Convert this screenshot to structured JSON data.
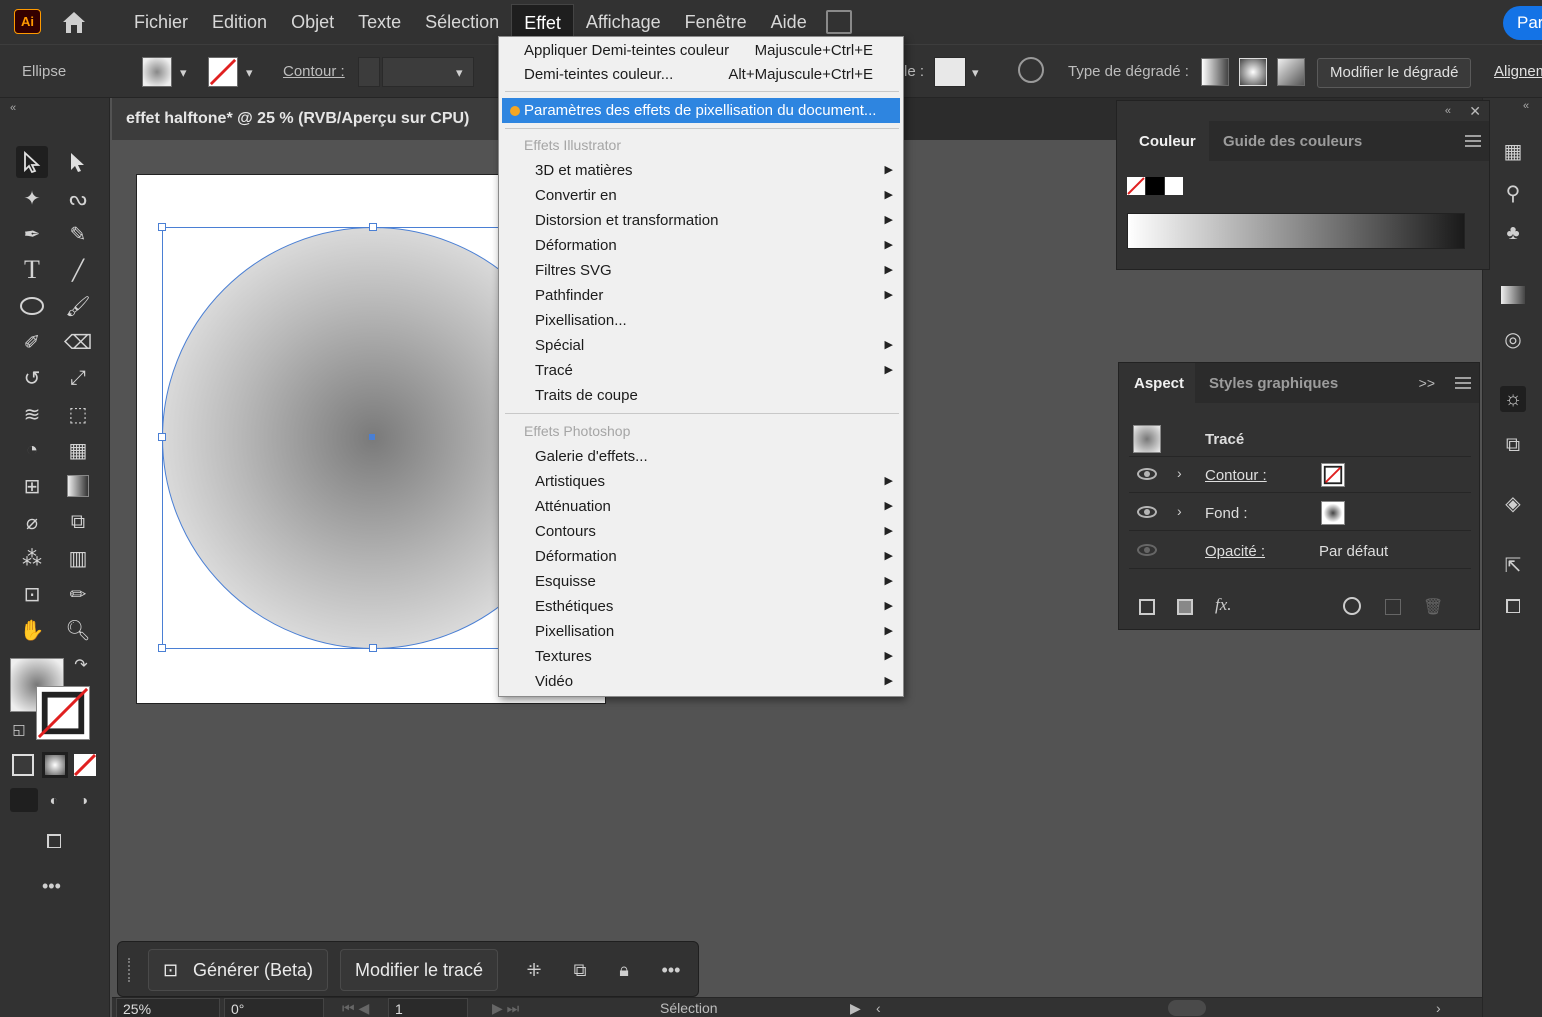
{
  "app": {
    "logo": "Ai"
  },
  "menubar": {
    "items": [
      "Fichier",
      "Edition",
      "Objet",
      "Texte",
      "Sélection",
      "Effet",
      "Affichage",
      "Fenêtre",
      "Aide"
    ],
    "active": "Effet",
    "share_label": "Par"
  },
  "controlbar": {
    "object_type": "Ellipse",
    "stroke_label": "Contour :",
    "opacity_label_partial": "le :",
    "gradient_type_label": "Type de dégradé :",
    "edit_gradient_label": "Modifier le dégradé",
    "align_label": "Alignem"
  },
  "document": {
    "tab_title": "effet halftone* @ 25 % (RVB/Aperçu sur CPU)"
  },
  "effect_menu": {
    "top_items": [
      {
        "label": "Appliquer Demi-teintes couleur",
        "shortcut": "Majuscule+Ctrl+E"
      },
      {
        "label": "Demi-teintes couleur...",
        "shortcut": "Alt+Majuscule+Ctrl+E"
      }
    ],
    "highlighted": "Paramètres des effets de pixellisation du document...",
    "illustrator_section": "Effets Illustrator",
    "illustrator_items": [
      {
        "label": "3D et matières",
        "submenu": true
      },
      {
        "label": "Convertir en",
        "submenu": true
      },
      {
        "label": "Distorsion et transformation",
        "submenu": true
      },
      {
        "label": "Déformation",
        "submenu": true
      },
      {
        "label": "Filtres SVG",
        "submenu": true
      },
      {
        "label": "Pathfinder",
        "submenu": true
      },
      {
        "label": "Pixellisation...",
        "submenu": false
      },
      {
        "label": "Spécial",
        "submenu": true
      },
      {
        "label": "Tracé",
        "submenu": true
      },
      {
        "label": "Traits de coupe",
        "submenu": false
      }
    ],
    "photoshop_section": "Effets Photoshop",
    "photoshop_items": [
      {
        "label": "Galerie d'effets...",
        "submenu": false
      },
      {
        "label": "Artistiques",
        "submenu": true
      },
      {
        "label": "Atténuation",
        "submenu": true
      },
      {
        "label": "Contours",
        "submenu": true
      },
      {
        "label": "Déformation",
        "submenu": true
      },
      {
        "label": "Esquisse",
        "submenu": true
      },
      {
        "label": "Esthétiques",
        "submenu": true
      },
      {
        "label": "Pixellisation",
        "submenu": true
      },
      {
        "label": "Textures",
        "submenu": true
      },
      {
        "label": "Vidéo",
        "submenu": true
      }
    ]
  },
  "color_panel": {
    "tab_active": "Couleur",
    "tab_inactive": "Guide des couleurs"
  },
  "aspect_panel": {
    "tab_active": "Aspect",
    "tab_inactive": "Styles graphiques",
    "header": "Tracé",
    "rows": {
      "stroke": "Contour :",
      "fill": "Fond :",
      "opacity": "Opacité :",
      "opacity_value": "Par défaut"
    },
    "fx_label": "fx."
  },
  "floating_bar": {
    "generate_label": "Générer (Beta)",
    "edit_path_label": "Modifier le tracé",
    "more": "•••"
  },
  "statusbar": {
    "zoom": "25%",
    "rotation": "0°",
    "artboard": "1",
    "tool": "Sélection"
  },
  "toolbar": {
    "more": "•••"
  },
  "colors": {
    "accent": "#2e85e0",
    "brand": "#ff9a00",
    "bounding_box": "#4a7fd4"
  }
}
